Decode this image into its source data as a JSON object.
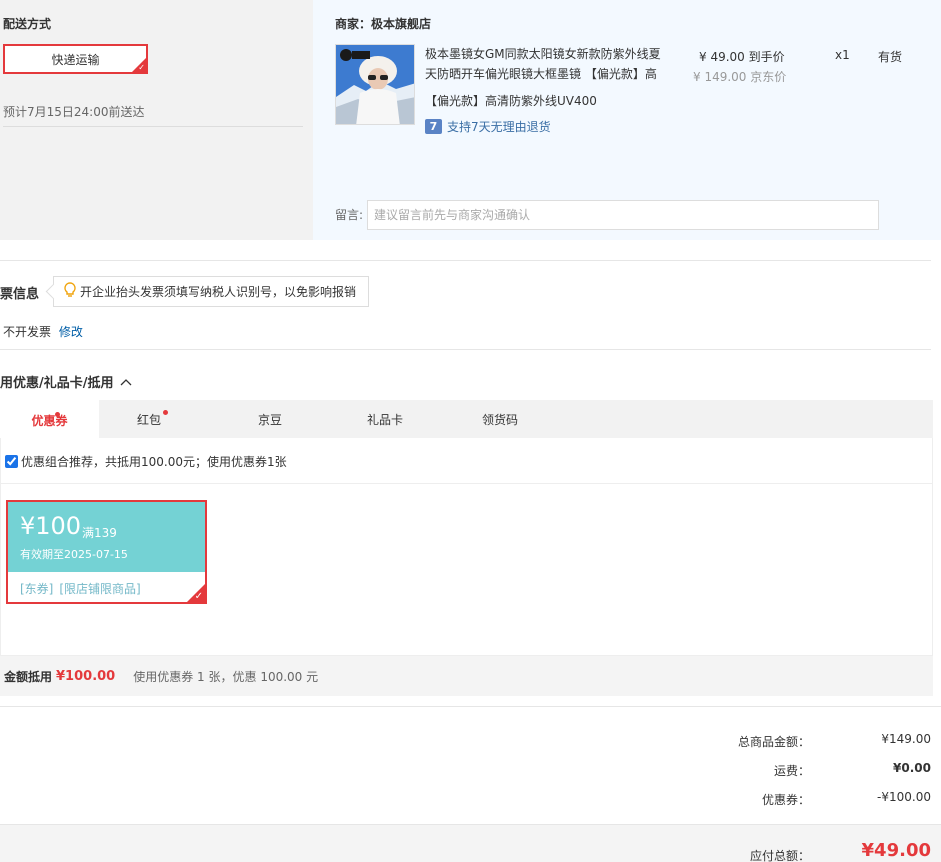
{
  "shipping": {
    "title": "配送方式",
    "method": "快递运输",
    "eta": "预计7月15日24:00前送达"
  },
  "shop": {
    "title": "商家：极本旗舰店",
    "product": {
      "name": "极本墨镜女GM同款太阳镜女新款防紫外线夏天防晒开车偏光眼镜大框墨镜 【偏光款】高",
      "variant": "【偏光款】高清防紫外线UV400",
      "return_badge": "7",
      "return_policy": "支持7天无理由退货",
      "price_now": "¥ 49.00 到手价",
      "price_jd": "¥ 149.00 京东价",
      "quantity": "x1",
      "stock": "有货",
      "image_icon": "product-photo"
    },
    "note": {
      "label": "留言:",
      "placeholder": "建议留言前先与商家沟通确认"
    }
  },
  "invoice": {
    "title": "票信息",
    "tip": "开企业抬头发票须填写纳税人识别号，以免影响报销",
    "value": "不开发票",
    "edit": "修改"
  },
  "coupons": {
    "title": "用优惠/礼品卡/抵用",
    "tabs": [
      {
        "label": "优惠券",
        "active": true,
        "dot": true
      },
      {
        "label": "红包",
        "active": false,
        "dot": true
      },
      {
        "label": "京豆",
        "active": false,
        "dot": false
      },
      {
        "label": "礼品卡",
        "active": false,
        "dot": false
      },
      {
        "label": "领货码",
        "active": false,
        "dot": false
      }
    ],
    "combo_text": "优惠组合推荐，共抵用100.00元；使用优惠券1张",
    "combo_checked": true,
    "coupon": {
      "amount": "¥100",
      "min": "满139",
      "validity": "有效期至2025-07-15",
      "tags": [
        "[东券]",
        "[限店铺限商品]"
      ]
    },
    "summary_label": "金额抵用",
    "summary_amount": "¥100.00",
    "summary_desc": "使用优惠券 1 张，优惠 100.00 元"
  },
  "totals": {
    "items_label": "总商品金额：",
    "items_value": "¥149.00",
    "freight_label": "运费：",
    "freight_value": "¥0.00",
    "coupon_label": "优惠券：",
    "coupon_value": "-¥100.00",
    "pay_label": "应付总额：",
    "pay_value": "¥49.00"
  },
  "colors": {
    "accent": "#e4393c",
    "coupon_teal": "#74d2d4",
    "link": "#005ea7",
    "shop_bg": "#f3f9ff"
  }
}
